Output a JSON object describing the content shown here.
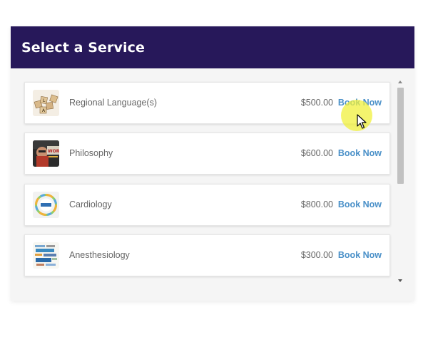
{
  "colors": {
    "header_bg": "#27185a",
    "accent": "#4a90c8"
  },
  "header": {
    "title": "Select a Service"
  },
  "services": [
    {
      "name": "Regional Language(s)",
      "price": "$500.00",
      "action": "Book Now",
      "icon": "scrabble-tiles-icon"
    },
    {
      "name": "Philosophy",
      "price": "$600.00",
      "action": "Book Now",
      "icon": "philosophy-book-icon"
    },
    {
      "name": "Cardiology",
      "price": "$800.00",
      "action": "Book Now",
      "icon": "cardiology-badge-icon"
    },
    {
      "name": "Anesthesiology",
      "price": "$300.00",
      "action": "Book Now",
      "icon": "word-cloud-icon"
    }
  ]
}
